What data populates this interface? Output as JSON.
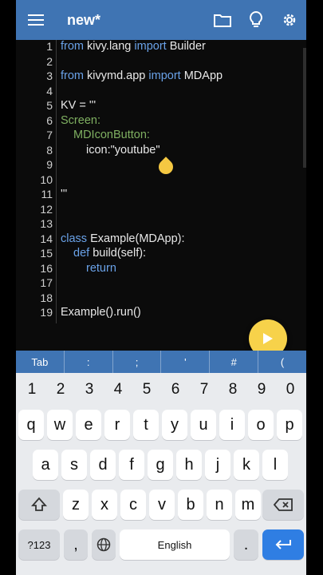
{
  "app": {
    "title": "new*",
    "icons": [
      "menu-icon",
      "folder-icon",
      "lightbulb-icon",
      "settings-icon"
    ]
  },
  "editor": {
    "line_numbers": [
      "1",
      "2",
      "3",
      "4",
      "5",
      "6",
      "7",
      "8",
      "9",
      "10",
      "11",
      "12",
      "13",
      "14",
      "15",
      "16",
      "17",
      "18",
      "19"
    ],
    "lines": [
      {
        "n": 1,
        "indent": 0,
        "parts": [
          {
            "t": "from",
            "c": "kw"
          },
          {
            "t": " kivy.lang "
          },
          {
            "t": "import",
            "c": "kw"
          },
          {
            "t": " Builder"
          }
        ]
      },
      {
        "n": 3,
        "indent": 0,
        "parts": [
          {
            "t": "from",
            "c": "kw"
          },
          {
            "t": " kivymd.app "
          },
          {
            "t": "import",
            "c": "kw"
          },
          {
            "t": " MDApp"
          }
        ]
      },
      {
        "n": 5,
        "indent": 0,
        "parts": [
          {
            "t": "KV = '''"
          }
        ]
      },
      {
        "n": 6,
        "indent": 0,
        "parts": [
          {
            "t": "Screen:",
            "c": "md"
          }
        ]
      },
      {
        "n": 7,
        "indent": 1,
        "parts": [
          {
            "t": "MDIconButton:",
            "c": "md"
          }
        ]
      },
      {
        "n": 8,
        "indent": 2,
        "parts": [
          {
            "t": "icon:\"youtube\""
          }
        ]
      },
      {
        "n": 11,
        "indent": 0,
        "parts": [
          {
            "t": "'''"
          }
        ]
      },
      {
        "n": 14,
        "indent": 0,
        "parts": [
          {
            "t": "class",
            "c": "kw"
          },
          {
            "t": " Example(MDApp):"
          }
        ]
      },
      {
        "n": 15,
        "indent": 1,
        "parts": [
          {
            "t": "def",
            "c": "kw"
          },
          {
            "t": " build(self):"
          }
        ]
      },
      {
        "n": 16,
        "indent": 2,
        "parts": [
          {
            "t": "return",
            "c": "kw"
          }
        ]
      },
      {
        "n": 19,
        "indent": 0,
        "parts": [
          {
            "t": "Example().run()"
          }
        ]
      }
    ],
    "run_button_icon": "play-icon"
  },
  "symbol_bar": [
    "Tab",
    ":",
    ";",
    "'",
    "#",
    "("
  ],
  "keyboard": {
    "numbers": [
      "1",
      "2",
      "3",
      "4",
      "5",
      "6",
      "7",
      "8",
      "9",
      "0"
    ],
    "row1": [
      "q",
      "w",
      "e",
      "r",
      "t",
      "y",
      "u",
      "i",
      "o",
      "p"
    ],
    "row2": [
      "a",
      "s",
      "d",
      "f",
      "g",
      "h",
      "j",
      "k",
      "l"
    ],
    "row3": [
      "z",
      "x",
      "c",
      "v",
      "b",
      "n",
      "m"
    ],
    "symbols_key": "?123",
    "comma_key": ",",
    "period_key": ".",
    "space_label": "English",
    "shift_icon": "shift-icon",
    "backspace_icon": "backspace-icon",
    "globe_icon": "globe-icon",
    "enter_icon": "enter-arrow-icon"
  },
  "colors": {
    "app_bar": "#3f74b3",
    "keyword": "#6aa2e8",
    "markup": "#7fb061",
    "accent": "#f7d24a",
    "enter_key": "#2f7ee3"
  }
}
